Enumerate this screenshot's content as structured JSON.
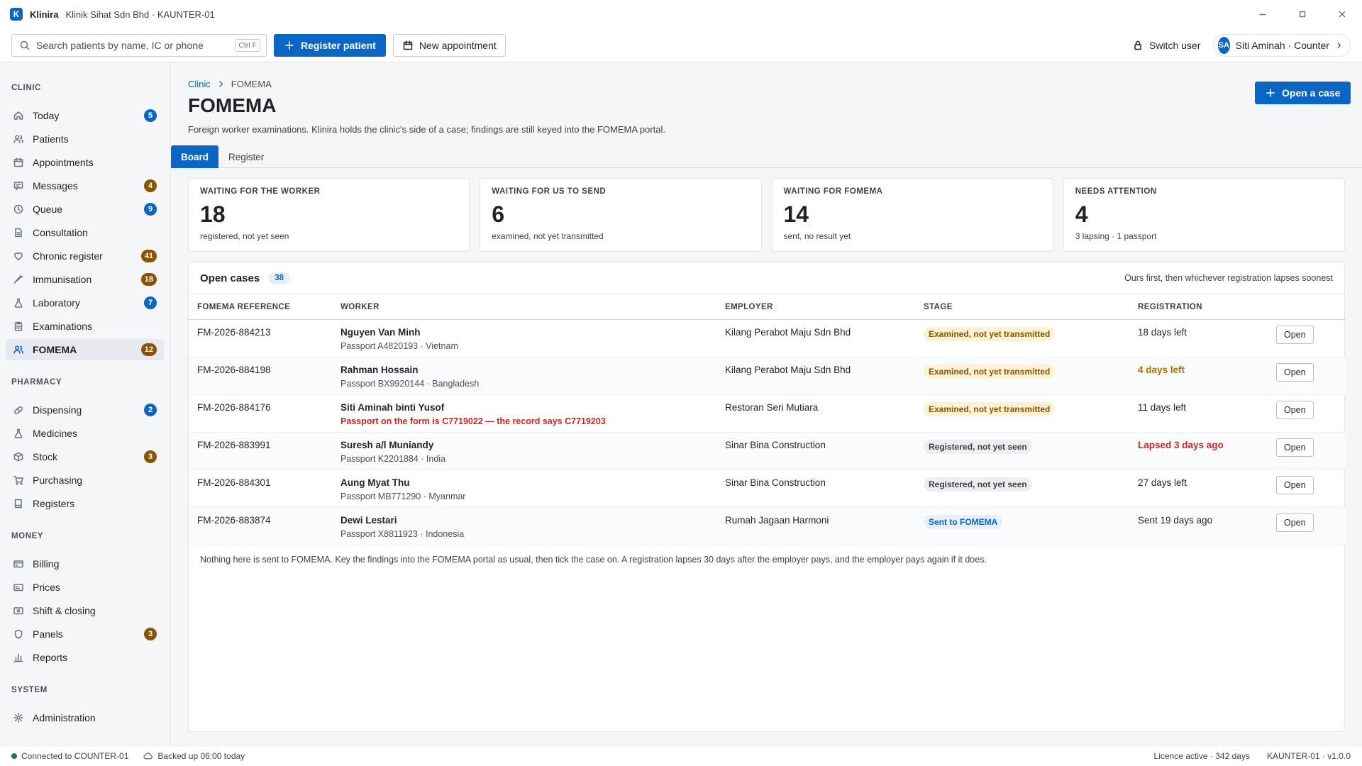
{
  "window": {
    "logo_letter": "K",
    "app_name": "Klinira",
    "subtitle": "Klinik Sihat Sdn Bhd · KAUNTER-01"
  },
  "toolbar": {
    "search_placeholder": "Search patients by name, IC or phone",
    "search_shortcut": "Ctrl F",
    "register_label": "Register patient",
    "appointment_label": "New appointment",
    "switch_user_label": "Switch user",
    "user_initials": "SA",
    "user_label": "Siti Aminah · Counter"
  },
  "sidebar": {
    "sections": [
      {
        "title": "CLINIC",
        "items": [
          {
            "label": "Today",
            "icon": "home-icon",
            "badge": "5",
            "badge_color": "blue"
          },
          {
            "label": "Patients",
            "icon": "users-icon",
            "badge": "",
            "badge_color": ""
          },
          {
            "label": "Appointments",
            "icon": "calendar-icon",
            "badge": "",
            "badge_color": ""
          },
          {
            "label": "Messages",
            "icon": "message-icon",
            "badge": "4",
            "badge_color": "brown"
          },
          {
            "label": "Queue",
            "icon": "clock-icon",
            "badge": "9",
            "badge_color": "blue"
          },
          {
            "label": "Consultation",
            "icon": "document-icon",
            "badge": "",
            "badge_color": ""
          },
          {
            "label": "Chronic register",
            "icon": "heart-icon",
            "badge": "41",
            "badge_color": "brown"
          },
          {
            "label": "Immunisation",
            "icon": "syringe-icon",
            "badge": "18",
            "badge_color": "brown"
          },
          {
            "label": "Laboratory",
            "icon": "flask-icon",
            "badge": "7",
            "badge_color": "blue"
          },
          {
            "label": "Examinations",
            "icon": "clipboard-icon",
            "badge": "",
            "badge_color": ""
          },
          {
            "label": "FOMEMA",
            "icon": "worker-icon",
            "badge": "12",
            "badge_color": "brown",
            "active": true
          }
        ]
      },
      {
        "title": "PHARMACY",
        "items": [
          {
            "label": "Dispensing",
            "icon": "pill-icon",
            "badge": "2",
            "badge_color": "blue"
          },
          {
            "label": "Medicines",
            "icon": "flask-icon",
            "badge": "",
            "badge_color": ""
          },
          {
            "label": "Stock",
            "icon": "box-icon",
            "badge": "3",
            "badge_color": "brown"
          },
          {
            "label": "Purchasing",
            "icon": "cart-icon",
            "badge": "",
            "badge_color": ""
          },
          {
            "label": "Registers",
            "icon": "book-icon",
            "badge": "",
            "badge_color": ""
          }
        ]
      },
      {
        "title": "MONEY",
        "items": [
          {
            "label": "Billing",
            "icon": "card-icon",
            "badge": "",
            "badge_color": ""
          },
          {
            "label": "Prices",
            "icon": "tag-icon",
            "badge": "",
            "badge_color": ""
          },
          {
            "label": "Shift & closing",
            "icon": "cash-icon",
            "badge": "",
            "badge_color": ""
          },
          {
            "label": "Panels",
            "icon": "shield-icon",
            "badge": "3",
            "badge_color": "brown"
          },
          {
            "label": "Reports",
            "icon": "bar-chart-icon",
            "badge": "",
            "badge_color": ""
          }
        ]
      },
      {
        "title": "SYSTEM",
        "items": [
          {
            "label": "Administration",
            "icon": "gear-icon",
            "badge": "",
            "badge_color": ""
          }
        ]
      }
    ]
  },
  "main": {
    "breadcrumb": {
      "root": "Clinic",
      "current": "FOMEMA"
    },
    "title": "FOMEMA",
    "description": "Foreign worker examinations. Klinira holds the clinic's side of a case; findings are still keyed into the FOMEMA portal.",
    "open_case_label": "Open a case",
    "tabs": [
      {
        "label": "Board",
        "active": true
      },
      {
        "label": "Register",
        "active": false
      }
    ],
    "kpis": [
      {
        "label": "WAITING FOR THE WORKER",
        "value": "18",
        "sub": "registered, not yet seen"
      },
      {
        "label": "WAITING FOR US TO SEND",
        "value": "6",
        "sub": "examined, not yet transmitted"
      },
      {
        "label": "WAITING FOR FOMEMA",
        "value": "14",
        "sub": "sent, no result yet"
      },
      {
        "label": "NEEDS ATTENTION",
        "value": "4",
        "sub": "3 lapsing · 1 passport"
      }
    ],
    "cases": {
      "title": "Open cases",
      "count": "38",
      "note": "Ours first, then whichever registration lapses soonest",
      "columns": [
        "FOMEMA REFERENCE",
        "WORKER",
        "EMPLOYER",
        "STAGE",
        "REGISTRATION",
        ""
      ],
      "open_label": "Open",
      "rows": [
        {
          "ref": "FM-2026-884213",
          "name": "Nguyen Van Minh",
          "sub": "Passport A4820193 · Vietnam",
          "sub_error": false,
          "employer": "Kilang Perabot Maju Sdn Bhd",
          "stage": "Examined, not yet transmitted",
          "stage_tone": "amber",
          "registration": "18 days left",
          "reg_tone": "normal"
        },
        {
          "ref": "FM-2026-884198",
          "name": "Rahman Hossain",
          "sub": "Passport BX9920144 · Bangladesh",
          "sub_error": false,
          "employer": "Kilang Perabot Maju Sdn Bhd",
          "stage": "Examined, not yet transmitted",
          "stage_tone": "amber",
          "registration": "4 days left",
          "reg_tone": "warn"
        },
        {
          "ref": "FM-2026-884176",
          "name": "Siti Aminah binti Yusof",
          "sub": "Passport on the form is C7719022 — the record says C7719203",
          "sub_error": true,
          "employer": "Restoran Seri Mutiara",
          "stage": "Examined, not yet transmitted",
          "stage_tone": "amber",
          "registration": "11 days left",
          "reg_tone": "normal"
        },
        {
          "ref": "FM-2026-883991",
          "name": "Suresh a/l Muniandy",
          "sub": "Passport K2201884 · India",
          "sub_error": false,
          "employer": "Sinar Bina Construction",
          "stage": "Registered, not yet seen",
          "stage_tone": "grey",
          "registration": "Lapsed 3 days ago",
          "reg_tone": "bad"
        },
        {
          "ref": "FM-2026-884301",
          "name": "Aung Myat Thu",
          "sub": "Passport MB771290 · Myanmar",
          "sub_error": false,
          "employer": "Sinar Bina Construction",
          "stage": "Registered, not yet seen",
          "stage_tone": "grey",
          "registration": "27 days left",
          "reg_tone": "normal"
        },
        {
          "ref": "FM-2026-883874",
          "name": "Dewi Lestari",
          "sub": "Passport X8811923 · Indonesia",
          "sub_error": false,
          "employer": "Rumah Jagaan Harmoni",
          "stage": "Sent to FOMEMA",
          "stage_tone": "blue",
          "registration": "Sent 19 days ago",
          "reg_tone": "normal"
        }
      ],
      "footnote": "Nothing here is sent to FOMEMA. Key the findings into the FOMEMA portal as usual, then tick the case on. A registration lapses 30 days after the employer pays, and the employer pays again if it does."
    }
  },
  "status": {
    "connection": "Connected to COUNTER-01",
    "backup": "Backed up 06:00 today",
    "licence": "Licence active · 342 days",
    "version": "KAUNTER-01 · v1.0.0"
  }
}
